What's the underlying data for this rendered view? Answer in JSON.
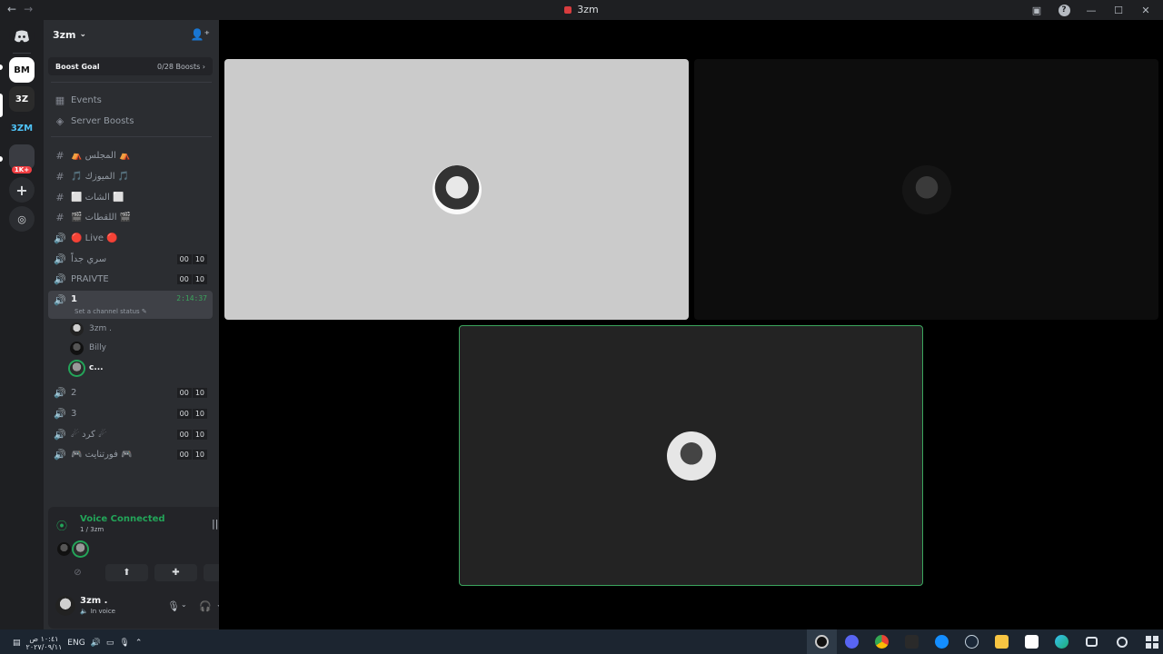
{
  "window": {
    "title": "3zm",
    "back_glyph": "←",
    "forward_glyph": "→",
    "help_glyph": "?",
    "minimize_glyph": "—",
    "maximize_glyph": "☐",
    "close_glyph": "✕"
  },
  "guilds": [
    {
      "label": "BM",
      "bg": "#ffffff",
      "fg": "#111111",
      "icon": "bm-server-icon"
    },
    {
      "label": "3Z",
      "bg": "#2b2b2b",
      "fg": "#ffffff",
      "icon": "3z-server-icon"
    },
    {
      "label": "3ZM",
      "bg": "#1e1f22",
      "fg": "#4fc3f7",
      "icon": "3zm-server-icon"
    },
    {
      "label": "1K+",
      "bg": "#3a3c42",
      "fg": "#ffffff",
      "icon": "folder-server-icon",
      "badge_color": "#f23f43"
    }
  ],
  "server": {
    "name": "3zm",
    "boost_goal_label": "Boost Goal",
    "boost_count": "0/28 Boosts"
  },
  "nav": [
    {
      "label": "Events",
      "icon": "calendar-icon"
    },
    {
      "label": "Server Boosts",
      "icon": "boost-icon"
    }
  ],
  "channels": [
    {
      "type": "text",
      "name": "⛺ المجلس ⛺"
    },
    {
      "type": "text",
      "name": "🎵 الميوزك 🎵"
    },
    {
      "type": "text",
      "name": "⬜ الشات ⬜"
    },
    {
      "type": "text",
      "name": "🎬 اللقطات 🎬"
    },
    {
      "type": "voice",
      "name": "🔴 Live 🔴"
    },
    {
      "type": "voice",
      "name": "سري جداً",
      "limit_a": "00",
      "limit_b": "10"
    },
    {
      "type": "voice",
      "name": "PRAIVTE",
      "limit_a": "00",
      "limit_b": "10"
    },
    {
      "type": "voice-active",
      "name": "1",
      "timer": "2:14:37",
      "status_placeholder": "Set a channel status"
    },
    {
      "type": "voice",
      "name": "2",
      "limit_a": "00",
      "limit_b": "10"
    },
    {
      "type": "voice",
      "name": "3",
      "limit_a": "00",
      "limit_b": "10"
    },
    {
      "type": "voice",
      "name": "☄ كرد ☄",
      "limit_a": "00",
      "limit_b": "10"
    },
    {
      "type": "voice",
      "name": "🎮 فورتنايت 🎮",
      "limit_a": "00",
      "limit_b": "10"
    }
  ],
  "members": [
    {
      "name": "3zm .",
      "style": "a"
    },
    {
      "name": "Billy",
      "style": "b"
    },
    {
      "name": "c...",
      "style": "c"
    }
  ],
  "voice": {
    "title": "Voice Connected",
    "subtitle": "1 / 3zm",
    "accent": "#23a559"
  },
  "user": {
    "name": "3zm .",
    "status": "In voice"
  },
  "stage": {
    "speaking_color": "#3ba55d"
  },
  "taskbar": {
    "language": "ENG",
    "time": "١٠:٤١ ص",
    "date": "٢٠٢٧/٠٩/١١"
  }
}
